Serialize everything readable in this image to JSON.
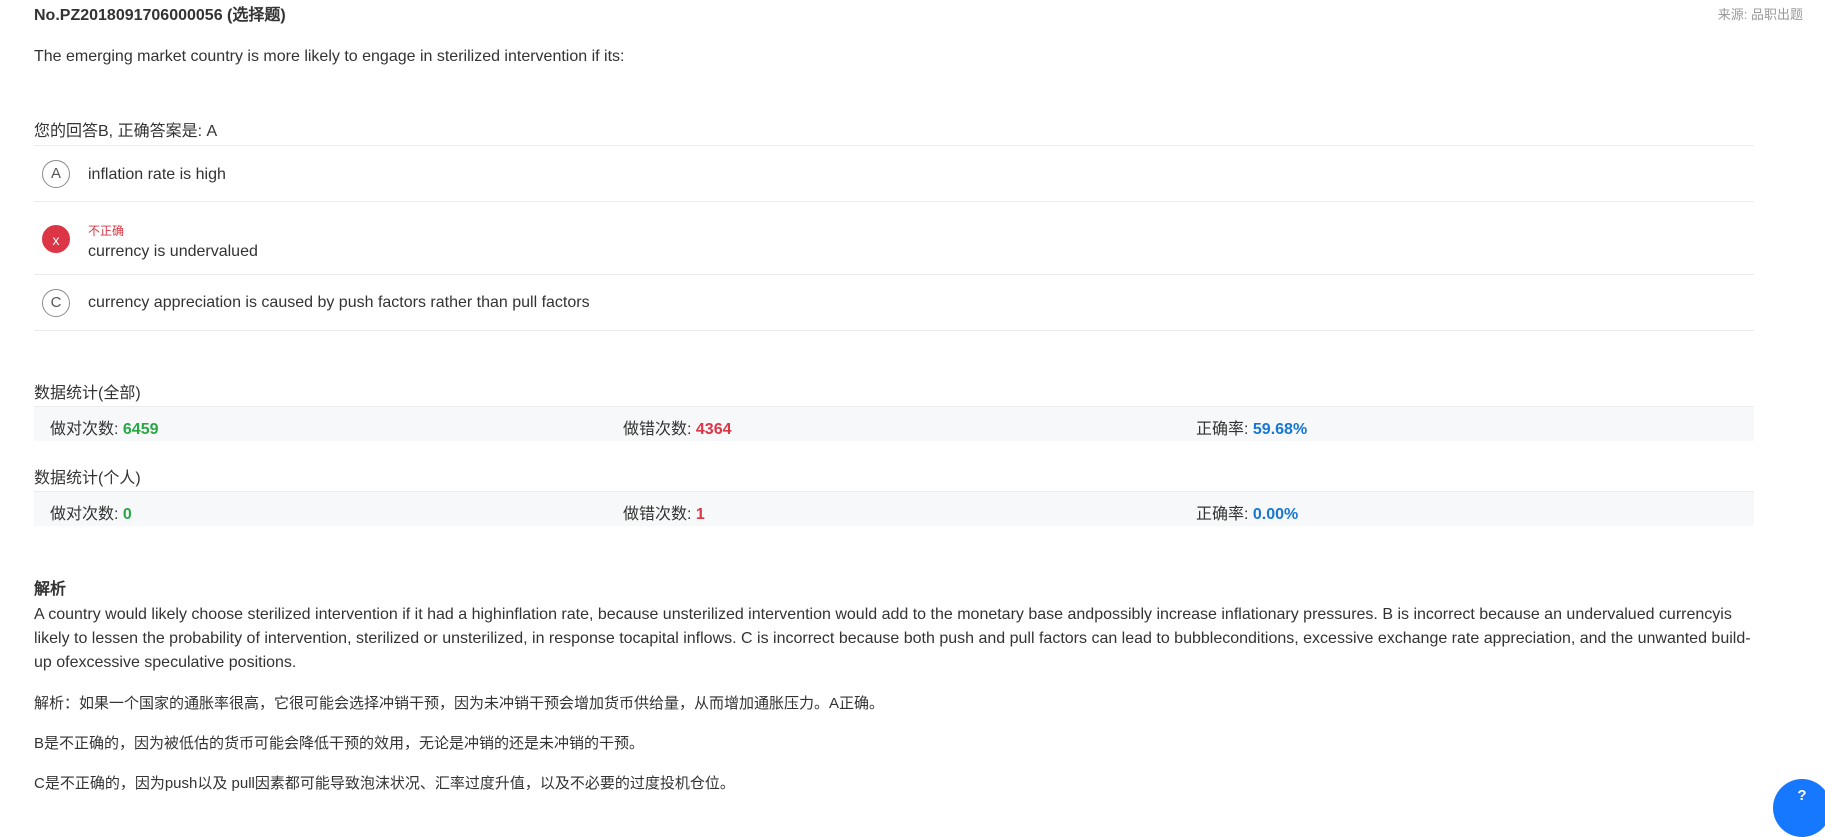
{
  "header": {
    "question_no": "No.PZ2018091706000056 (选择题)",
    "source": "来源: 品职出题"
  },
  "question": {
    "stem": "The emerging market country is more likely to engage in sterilized intervention if its:",
    "answer_line": "您的回答B, 正确答案是: A"
  },
  "options": [
    {
      "letter": "A",
      "text": "inflation rate is high"
    },
    {
      "letter": "x",
      "status": "不正确",
      "text": "currency is undervalued"
    },
    {
      "letter": "C",
      "text": "currency appreciation is caused by push factors rather than pull factors"
    }
  ],
  "stats_all": {
    "title": "数据统计(全部)",
    "correct_label": "做对次数: ",
    "correct_value": "6459",
    "wrong_label": "做错次数: ",
    "wrong_value": "4364",
    "rate_label": "正确率: ",
    "rate_value": "59.68%"
  },
  "stats_personal": {
    "title": "数据统计(个人)",
    "correct_label": "做对次数: ",
    "correct_value": "0",
    "wrong_label": "做错次数: ",
    "wrong_value": "1",
    "rate_label": "正确率: ",
    "rate_value": "0.00%"
  },
  "analysis": {
    "title": "解析",
    "en": "A country would likely choose sterilized intervention if it had a highinflation rate, because unsterilized intervention would add to the monetary base andpossibly increase inflationary pressures. B is incorrect because an undervalued currencyis likely to lessen the probability of intervention, sterilized or unsterilized, in response tocapital inflows. C is incorrect because both push and pull factors can lead to bubbleconditions, excessive exchange rate appreciation, and the unwanted build-up ofexcessive speculative positions.",
    "zh_1": "解析：如果一个国家的通胀率很高，它很可能会选择冲销干预，因为未冲销干预会增加货币供给量，从而增加通胀压力。A正确。",
    "zh_2": "B是不正确的，因为被低估的货币可能会降低干预的效用，无论是冲销的还是未冲销的干预。",
    "zh_3": "C是不正确的，因为push以及 pull因素都可能导致泡沫状况、汇率过度升值，以及不必要的过度投机仓位。"
  },
  "help": {
    "label": "?"
  },
  "colors": {
    "correct_green": "#28a745",
    "wrong_red": "#dc3545",
    "rate_blue": "#1677d6",
    "help_blue": "#1677ff"
  },
  "icons": {
    "wrong_mark": "x-mark-icon",
    "help": "help-icon"
  }
}
